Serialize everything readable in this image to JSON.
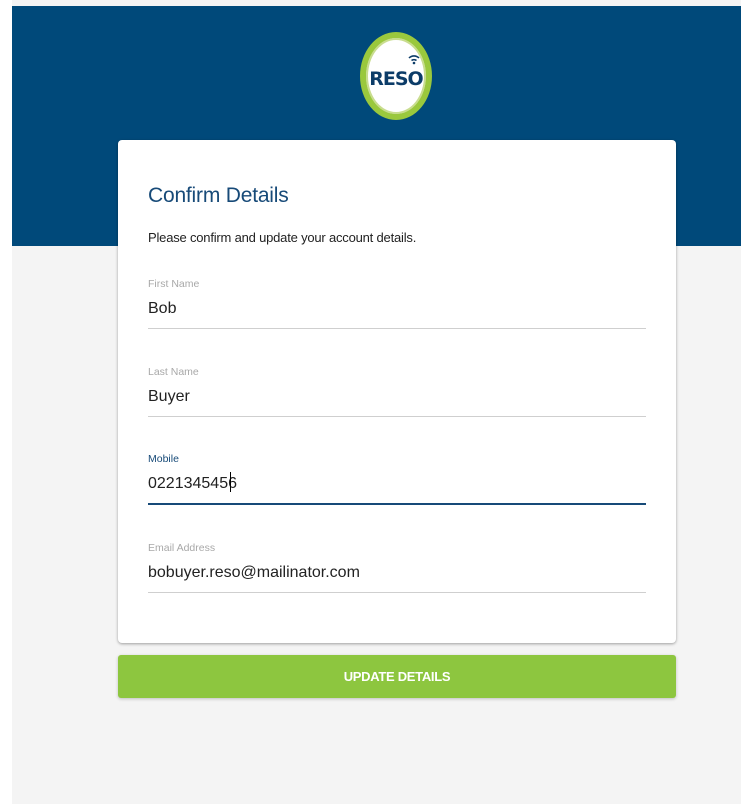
{
  "brand": {
    "logo_text": "RESO",
    "colors": {
      "header": "#00497a",
      "logo_ring": "#9ac83d",
      "title": "#174a78",
      "button": "#8dc63f"
    }
  },
  "form": {
    "title": "Confirm Details",
    "subtitle": "Please confirm and update your account details.",
    "fields": {
      "first_name": {
        "label": "First Name",
        "value": "Bob"
      },
      "last_name": {
        "label": "Last Name",
        "value": "Buyer"
      },
      "mobile": {
        "label": "Mobile",
        "value": "0221345456",
        "focused": true
      },
      "email": {
        "label": "Email Address",
        "value": "bobuyer.reso@mailinator.com"
      }
    },
    "submit_label": "UPDATE DETAILS"
  }
}
